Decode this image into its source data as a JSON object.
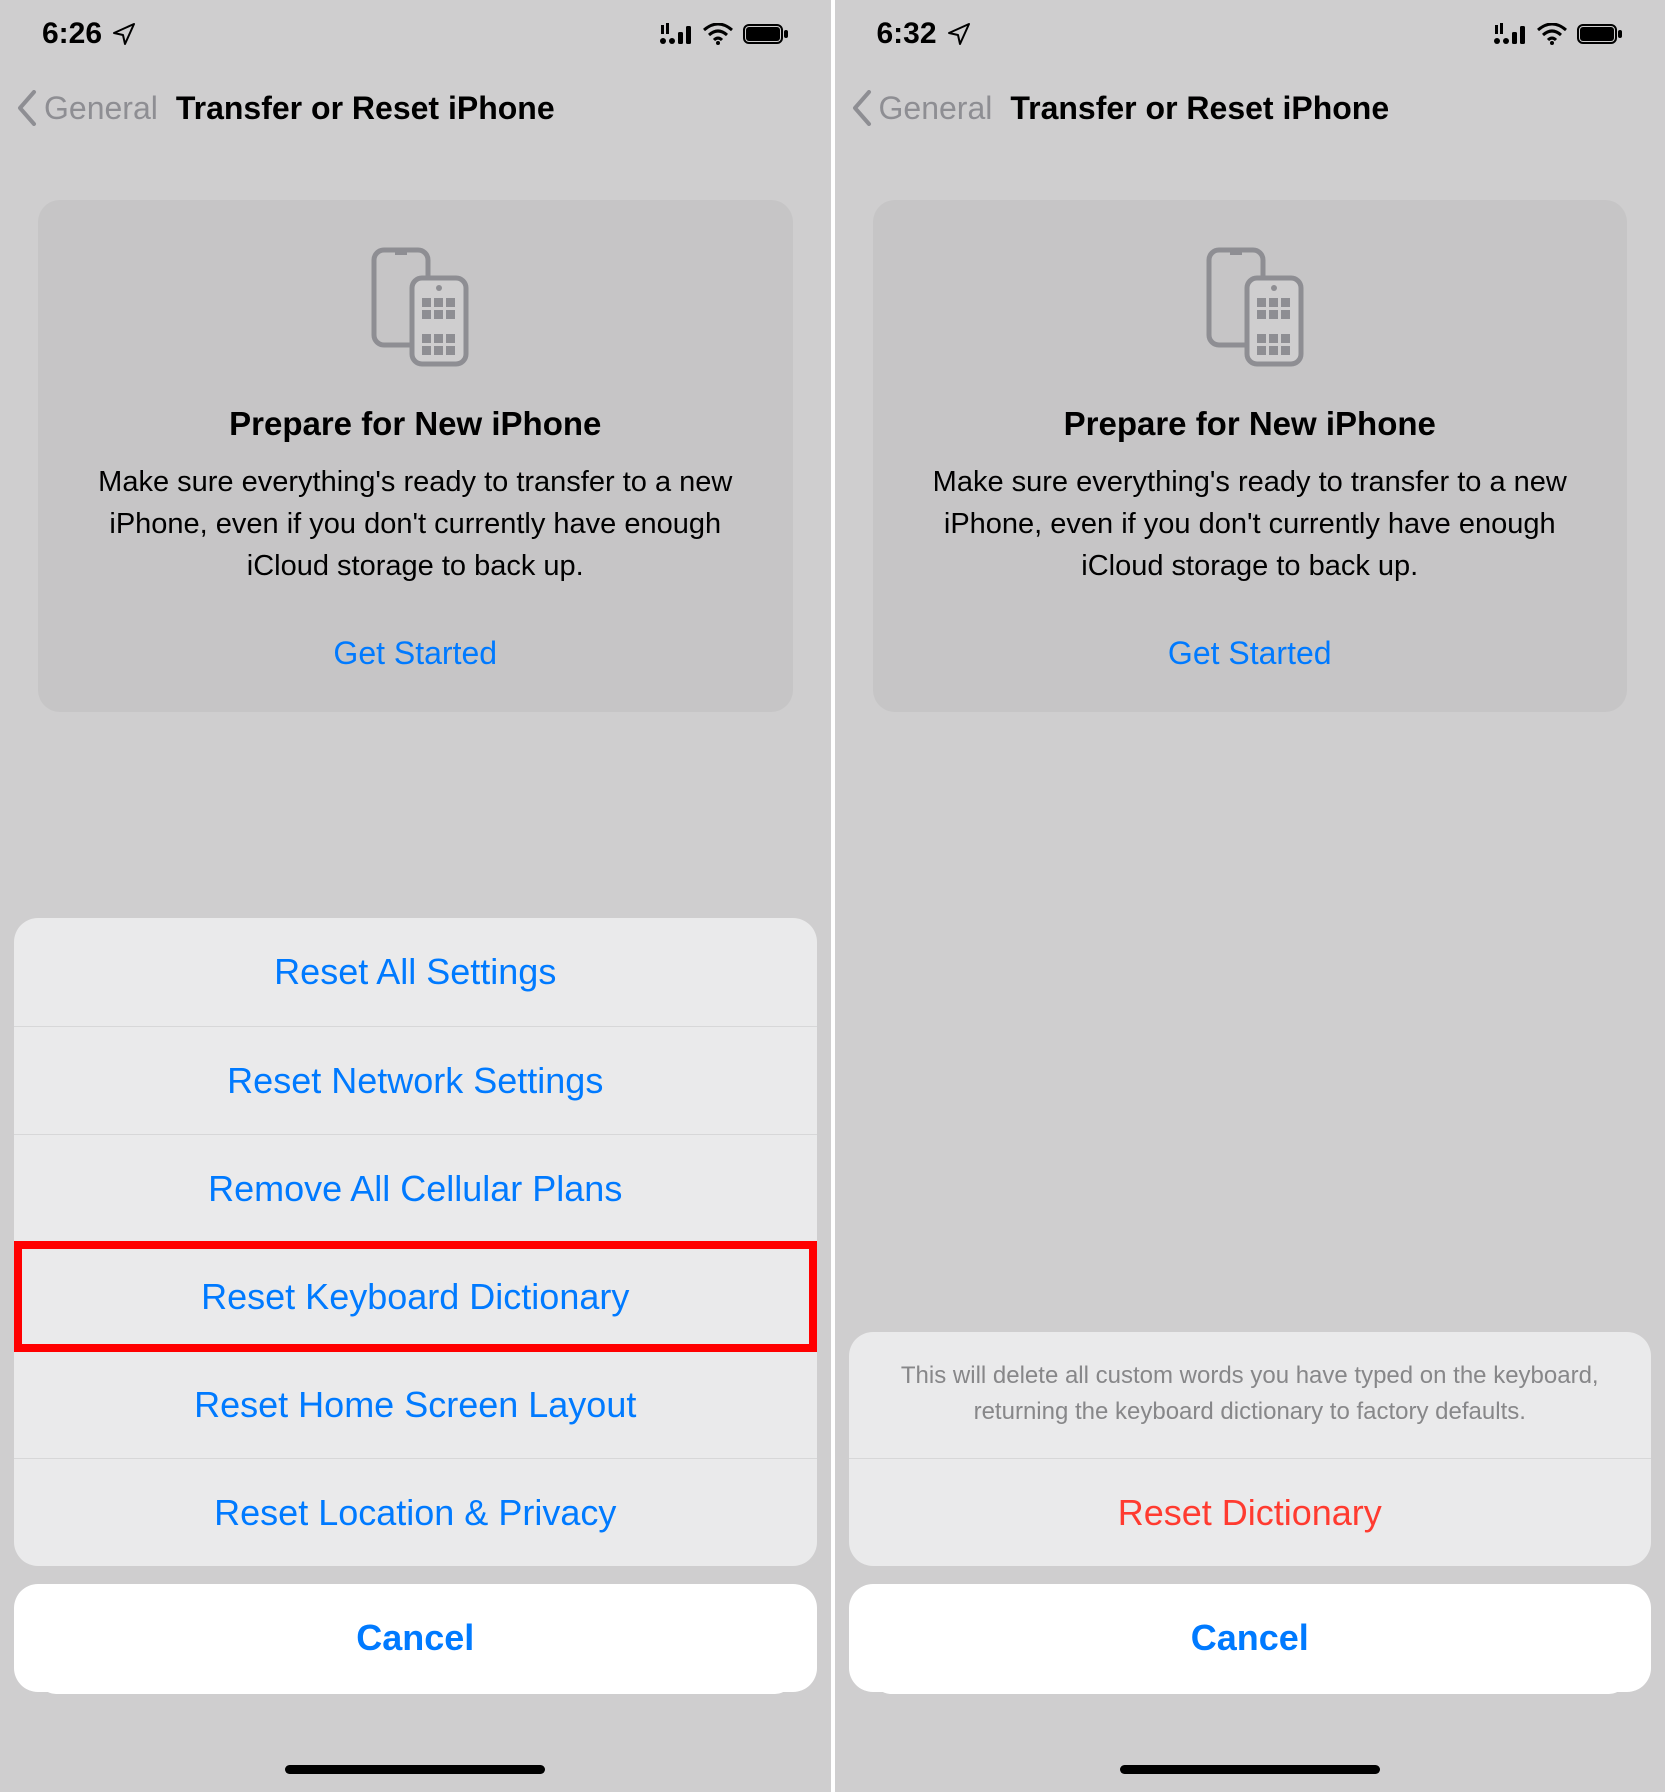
{
  "left": {
    "time": "6:26",
    "back_label": "General",
    "title": "Transfer or Reset iPhone",
    "card": {
      "title": "Prepare for New iPhone",
      "desc": "Make sure everything's ready to transfer to a new iPhone, even if you don't currently have enough iCloud storage to back up.",
      "cta": "Get Started"
    },
    "sheet": {
      "items": [
        "Reset All Settings",
        "Reset Network Settings",
        "Remove All Cellular Plans",
        "Reset Keyboard Dictionary",
        "Reset Home Screen Layout",
        "Reset Location & Privacy"
      ],
      "cancel": "Cancel"
    }
  },
  "right": {
    "time": "6:32",
    "back_label": "General",
    "title": "Transfer or Reset iPhone",
    "card": {
      "title": "Prepare for New iPhone",
      "desc": "Make sure everything's ready to transfer to a new iPhone, even if you don't currently have enough iCloud storage to back up.",
      "cta": "Get Started"
    },
    "confirm": {
      "message": "This will delete all custom words you have typed on the keyboard, returning the keyboard dictionary to factory defaults.",
      "action": "Reset Dictionary",
      "cancel": "Cancel"
    }
  }
}
